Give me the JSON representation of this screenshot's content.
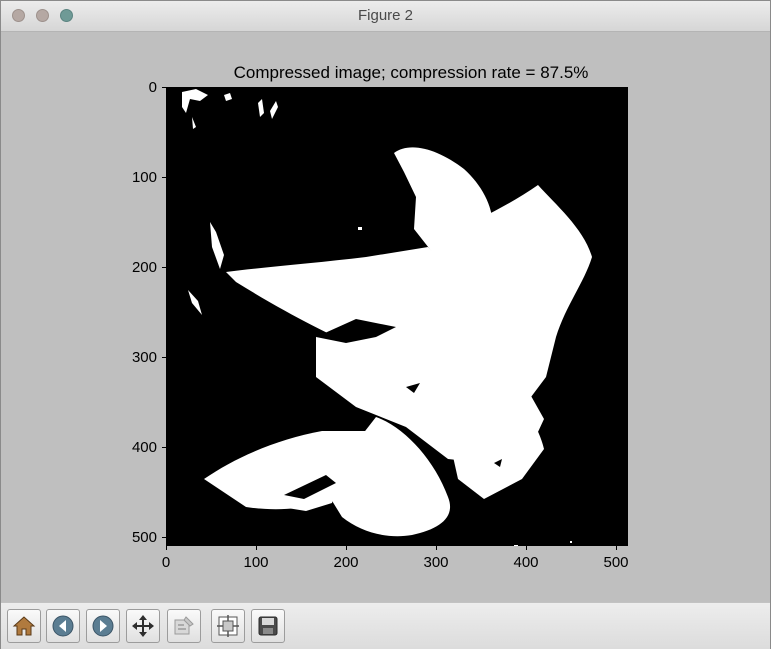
{
  "window": {
    "title": "Figure 2"
  },
  "plot": {
    "title": "Compressed image; compression rate = 87.5%",
    "y_ticks": [
      "0",
      "100",
      "200",
      "300",
      "400",
      "500"
    ],
    "x_ticks": [
      "0",
      "100",
      "200",
      "300",
      "400",
      "500"
    ],
    "image": "binary black-and-white lily flower"
  },
  "toolbar": {
    "buttons": [
      "home-icon",
      "back-icon",
      "forward-icon",
      "pan-icon",
      "zoom-icon",
      "subplots-icon",
      "save-icon"
    ]
  }
}
